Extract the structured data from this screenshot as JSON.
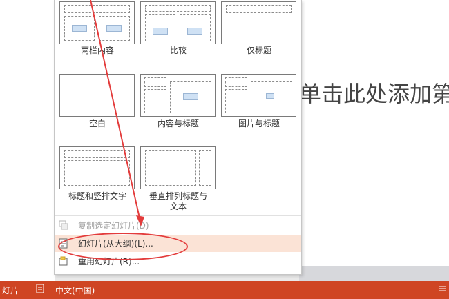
{
  "slide": {
    "placeholder_text": "单击此处添加第"
  },
  "layouts": [
    {
      "label": "两栏内容"
    },
    {
      "label": "比较"
    },
    {
      "label": "仅标题"
    },
    {
      "label": "空白"
    },
    {
      "label": "内容与标题"
    },
    {
      "label": "图片与标题"
    },
    {
      "label": "标题和竖排文字"
    },
    {
      "label": "垂直排列标题与\n文本"
    }
  ],
  "menu": {
    "items": [
      {
        "label": "复制选定幻灯片(D)",
        "icon": "duplicate-slide-icon",
        "state": "disabled"
      },
      {
        "label": "幻灯片(从大纲)(L)...",
        "icon": "outline-slide-icon",
        "state": "hover"
      },
      {
        "label": "重用幻灯片(R)...",
        "icon": "reuse-slide-icon",
        "state": "normal"
      }
    ]
  },
  "statusbar": {
    "slide_text": "灯片",
    "language": "中文(中国)",
    "color": "#cf4523"
  },
  "annotation": {
    "color": "#e33b3b"
  }
}
